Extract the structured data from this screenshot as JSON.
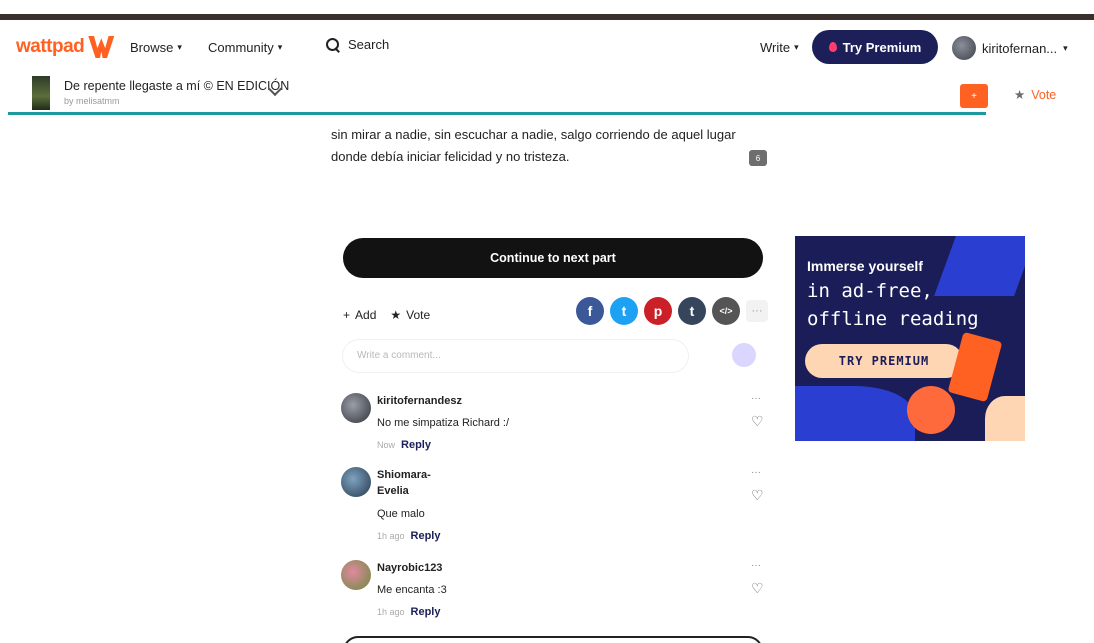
{
  "nav": {
    "logo_text": "wattpad",
    "browse": "Browse",
    "community": "Community",
    "search": "Search",
    "write": "Write",
    "try_premium": "Try Premium",
    "username": "kiritofernan..."
  },
  "story": {
    "title": "De repente llegaste a mí © EN EDICIÓN",
    "author": "by melisatmm",
    "vote": "Vote",
    "text": "sin mirar a nadie, sin escuchar a nadie, salgo corriendo de aquel lugar donde debía iniciar felicidad y no tristeza.",
    "inline_comment_count": "6"
  },
  "continue_label": "Continue to next part",
  "actions": {
    "add": "Add",
    "vote": "Vote"
  },
  "comment_placeholder": "Write a comment...",
  "comments": [
    {
      "name": "kiritofernandesz",
      "text": "No me simpatiza Richard :/",
      "time": "Now",
      "reply": "Reply"
    },
    {
      "name": "Shiomara-Evelia",
      "text": "Que malo",
      "time": "1h ago",
      "reply": "Reply"
    },
    {
      "name": "Nayrobic123",
      "text": "Me encanta :3",
      "time": "1h ago",
      "reply": "Reply"
    }
  ],
  "ad": {
    "line1": "Immerse yourself",
    "line2": "in ad-free,",
    "line3": "offline reading",
    "button": "TRY PREMIUM"
  },
  "colors": {
    "brand": "#ff6122",
    "premium": "#1c1f58",
    "accent_line": "#1d9aa0"
  }
}
